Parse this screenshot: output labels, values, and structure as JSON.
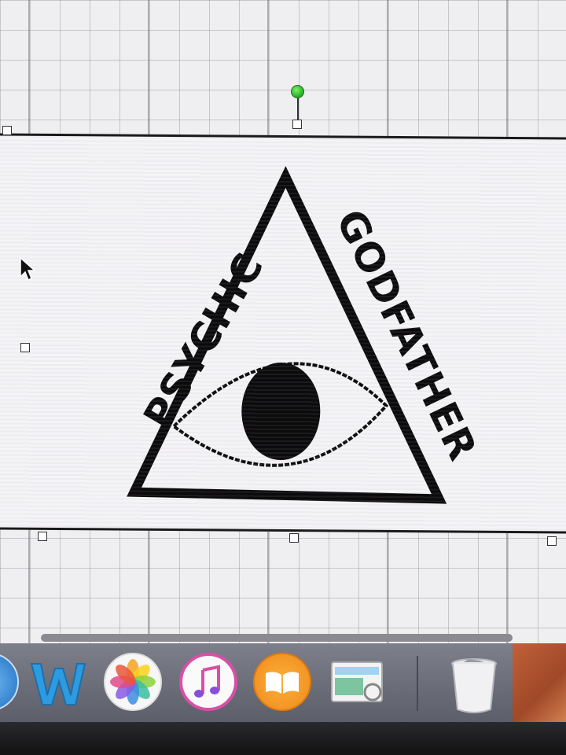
{
  "canvas": {
    "grid": "on",
    "background_color": "#efeff1"
  },
  "logo": {
    "left_text": "PSYCHIC",
    "right_text": "GODFATHER",
    "shape": "triangle-with-eye",
    "ink_color": "#0b0b0b"
  },
  "selection": {
    "rotate_handle_color": "#3cc43c"
  },
  "dock": {
    "items": [
      {
        "icon": "finder-icon"
      },
      {
        "icon": "word-icon"
      },
      {
        "icon": "photos-icon"
      },
      {
        "icon": "itunes-icon"
      },
      {
        "icon": "ibooks-icon"
      },
      {
        "icon": "preview-icon"
      },
      {
        "icon": "trash-icon"
      }
    ]
  }
}
